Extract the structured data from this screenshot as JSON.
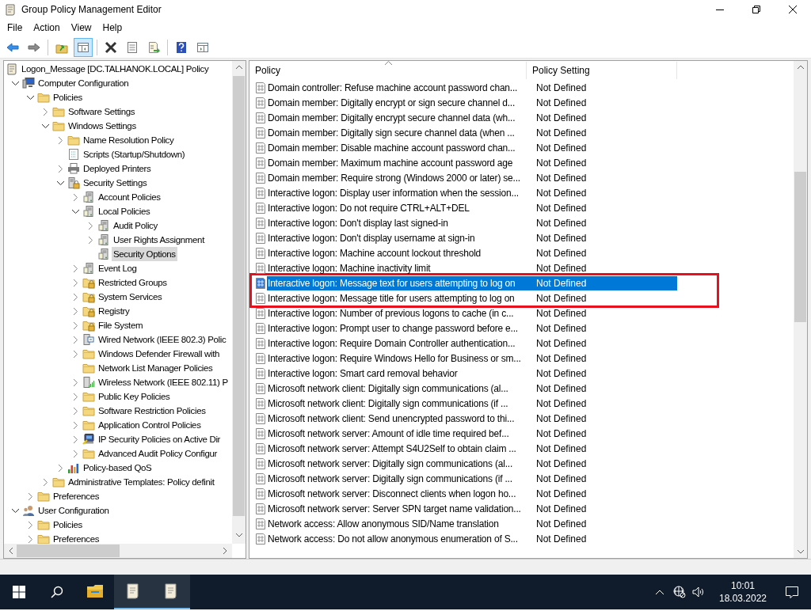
{
  "window": {
    "title": "Group Policy Management Editor"
  },
  "menu": [
    "File",
    "Action",
    "View",
    "Help"
  ],
  "toolbar": [
    {
      "kind": "back",
      "pressed": false
    },
    {
      "kind": "forward",
      "pressed": false
    },
    {
      "kind": "separator"
    },
    {
      "kind": "up",
      "pressed": false
    },
    {
      "kind": "tree-toggle",
      "pressed": true
    },
    {
      "kind": "separator"
    },
    {
      "kind": "delete",
      "pressed": false
    },
    {
      "kind": "properties",
      "pressed": false
    },
    {
      "kind": "export",
      "pressed": false
    },
    {
      "kind": "separator"
    },
    {
      "kind": "help",
      "pressed": false
    },
    {
      "kind": "action-pane",
      "pressed": false
    }
  ],
  "tree": [
    {
      "label": "Logon_Message [DC.TALHANOK.LOCAL] Policy",
      "kind": "policy",
      "selected": false,
      "children": [
        {
          "label": "Computer Configuration",
          "kind": "computer",
          "expanded": true,
          "selected": false,
          "children": [
            {
              "label": "Policies",
              "kind": "folder",
              "expanded": true,
              "selected": false,
              "children": [
                {
                  "label": "Software Settings",
                  "kind": "folder",
                  "expanded": false,
                  "selected": false
                },
                {
                  "label": "Windows Settings",
                  "kind": "folder",
                  "expanded": true,
                  "selected": false,
                  "children": [
                    {
                      "label": "Name Resolution Policy",
                      "kind": "folder",
                      "expanded": false,
                      "selected": false
                    },
                    {
                      "label": "Scripts (Startup/Shutdown)",
                      "kind": "scripts",
                      "selected": false
                    },
                    {
                      "label": "Deployed Printers",
                      "kind": "printer",
                      "expanded": false,
                      "selected": false
                    },
                    {
                      "label": "Security Settings",
                      "kind": "security",
                      "expanded": true,
                      "selected": false,
                      "children": [
                        {
                          "label": "Account Policies",
                          "kind": "server",
                          "expanded": false,
                          "selected": false
                        },
                        {
                          "label": "Local Policies",
                          "kind": "server",
                          "expanded": true,
                          "selected": false,
                          "children": [
                            {
                              "label": "Audit Policy",
                              "kind": "server",
                              "expanded": false,
                              "selected": false
                            },
                            {
                              "label": "User Rights Assignment",
                              "kind": "server",
                              "expanded": false,
                              "selected": false
                            },
                            {
                              "label": "Security Options",
                              "kind": "server",
                              "selected": true
                            }
                          ]
                        },
                        {
                          "label": "Event Log",
                          "kind": "server",
                          "expanded": false,
                          "selected": false
                        },
                        {
                          "label": "Restricted Groups",
                          "kind": "locked-folder",
                          "expanded": false,
                          "selected": false
                        },
                        {
                          "label": "System Services",
                          "kind": "locked-folder",
                          "expanded": false,
                          "selected": false
                        },
                        {
                          "label": "Registry",
                          "kind": "locked-folder",
                          "expanded": false,
                          "selected": false
                        },
                        {
                          "label": "File System",
                          "kind": "locked-folder",
                          "expanded": false,
                          "selected": false
                        },
                        {
                          "label": "Wired Network (IEEE 802.3) Polic",
                          "kind": "network",
                          "expanded": false,
                          "selected": false
                        },
                        {
                          "label": "Windows Defender Firewall with",
                          "kind": "folder",
                          "expanded": false,
                          "selected": false
                        },
                        {
                          "label": "Network List Manager Policies",
                          "kind": "folder",
                          "selected": false
                        },
                        {
                          "label": "Wireless Network (IEEE 802.11) P",
                          "kind": "wireless",
                          "expanded": false,
                          "selected": false
                        },
                        {
                          "label": "Public Key Policies",
                          "kind": "folder",
                          "expanded": false,
                          "selected": false
                        },
                        {
                          "label": "Software Restriction Policies",
                          "kind": "folder",
                          "expanded": false,
                          "selected": false
                        },
                        {
                          "label": "Application Control Policies",
                          "kind": "folder",
                          "expanded": false,
                          "selected": false
                        },
                        {
                          "label": "IP Security Policies on Active Dir",
                          "kind": "ip-security",
                          "expanded": false,
                          "selected": false
                        },
                        {
                          "label": "Advanced Audit Policy Configur",
                          "kind": "folder",
                          "expanded": false,
                          "selected": false
                        }
                      ]
                    },
                    {
                      "label": "Policy-based QoS",
                      "kind": "qos",
                      "expanded": false,
                      "selected": false
                    }
                  ]
                },
                {
                  "label": "Administrative Templates: Policy definit",
                  "kind": "folder",
                  "expanded": false,
                  "selected": false
                }
              ]
            },
            {
              "label": "Preferences",
              "kind": "folder",
              "expanded": false,
              "selected": false
            }
          ]
        },
        {
          "label": "User Configuration",
          "kind": "user",
          "expanded": true,
          "selected": false,
          "children": [
            {
              "label": "Policies",
              "kind": "folder",
              "expanded": false,
              "selected": false
            },
            {
              "label": "Preferences",
              "kind": "folder",
              "expanded": false,
              "selected": false
            }
          ]
        }
      ]
    }
  ],
  "table": {
    "columns": [
      "Policy",
      "Policy Setting"
    ],
    "rows": [
      {
        "policy": "Domain controller: Refuse machine account password chan...",
        "setting": "Not Defined",
        "selected": false,
        "annotated": false
      },
      {
        "policy": "Domain member: Digitally encrypt or sign secure channel d...",
        "setting": "Not Defined",
        "selected": false,
        "annotated": false
      },
      {
        "policy": "Domain member: Digitally encrypt secure channel data (wh...",
        "setting": "Not Defined",
        "selected": false,
        "annotated": false
      },
      {
        "policy": "Domain member: Digitally sign secure channel data (when ...",
        "setting": "Not Defined",
        "selected": false,
        "annotated": false
      },
      {
        "policy": "Domain member: Disable machine account password chan...",
        "setting": "Not Defined",
        "selected": false,
        "annotated": false
      },
      {
        "policy": "Domain member: Maximum machine account password age",
        "setting": "Not Defined",
        "selected": false,
        "annotated": false
      },
      {
        "policy": "Domain member: Require strong (Windows 2000 or later) se...",
        "setting": "Not Defined",
        "selected": false,
        "annotated": false
      },
      {
        "policy": "Interactive logon: Display user information when the session...",
        "setting": "Not Defined",
        "selected": false,
        "annotated": false
      },
      {
        "policy": "Interactive logon: Do not require CTRL+ALT+DEL",
        "setting": "Not Defined",
        "selected": false,
        "annotated": false
      },
      {
        "policy": "Interactive logon: Don't display last signed-in",
        "setting": "Not Defined",
        "selected": false,
        "annotated": false
      },
      {
        "policy": "Interactive logon: Don't display username at sign-in",
        "setting": "Not Defined",
        "selected": false,
        "annotated": false
      },
      {
        "policy": "Interactive logon: Machine account lockout threshold",
        "setting": "Not Defined",
        "selected": false,
        "annotated": false
      },
      {
        "policy": "Interactive logon: Machine inactivity limit",
        "setting": "Not Defined",
        "selected": false,
        "annotated": false
      },
      {
        "policy": "Interactive logon: Message text for users attempting to log on",
        "setting": "Not Defined",
        "selected": true,
        "annotated": true
      },
      {
        "policy": "Interactive logon: Message title for users attempting to log on",
        "setting": "Not Defined",
        "selected": false,
        "annotated": true
      },
      {
        "policy": "Interactive logon: Number of previous logons to cache (in c...",
        "setting": "Not Defined",
        "selected": false,
        "annotated": false
      },
      {
        "policy": "Interactive logon: Prompt user to change password before e...",
        "setting": "Not Defined",
        "selected": false,
        "annotated": false
      },
      {
        "policy": "Interactive logon: Require Domain Controller authentication...",
        "setting": "Not Defined",
        "selected": false,
        "annotated": false
      },
      {
        "policy": "Interactive logon: Require Windows Hello for Business or sm...",
        "setting": "Not Defined",
        "selected": false,
        "annotated": false
      },
      {
        "policy": "Interactive logon: Smart card removal behavior",
        "setting": "Not Defined",
        "selected": false,
        "annotated": false
      },
      {
        "policy": "Microsoft network client: Digitally sign communications (al...",
        "setting": "Not Defined",
        "selected": false,
        "annotated": false
      },
      {
        "policy": "Microsoft network client: Digitally sign communications (if ...",
        "setting": "Not Defined",
        "selected": false,
        "annotated": false
      },
      {
        "policy": "Microsoft network client: Send unencrypted password to thi...",
        "setting": "Not Defined",
        "selected": false,
        "annotated": false
      },
      {
        "policy": "Microsoft network server: Amount of idle time required bef...",
        "setting": "Not Defined",
        "selected": false,
        "annotated": false
      },
      {
        "policy": "Microsoft network server: Attempt S4U2Self to obtain claim ...",
        "setting": "Not Defined",
        "selected": false,
        "annotated": false
      },
      {
        "policy": "Microsoft network server: Digitally sign communications (al...",
        "setting": "Not Defined",
        "selected": false,
        "annotated": false
      },
      {
        "policy": "Microsoft network server: Digitally sign communications (if ...",
        "setting": "Not Defined",
        "selected": false,
        "annotated": false
      },
      {
        "policy": "Microsoft network server: Disconnect clients when logon ho...",
        "setting": "Not Defined",
        "selected": false,
        "annotated": false
      },
      {
        "policy": "Microsoft network server: Server SPN target name validation...",
        "setting": "Not Defined",
        "selected": false,
        "annotated": false
      },
      {
        "policy": "Network access: Allow anonymous SID/Name translation",
        "setting": "Not Defined",
        "selected": false,
        "annotated": false
      },
      {
        "policy": "Network access: Do not allow anonymous enumeration of S...",
        "setting": "Not Defined",
        "selected": false,
        "annotated": false
      }
    ]
  },
  "taskbar": {
    "apps": [
      {
        "kind": "explorer",
        "active": false
      },
      {
        "kind": "policy-editor",
        "active": true
      },
      {
        "kind": "policy-editor",
        "active": true
      }
    ],
    "time": "10:01",
    "date": "18.03.2022"
  }
}
